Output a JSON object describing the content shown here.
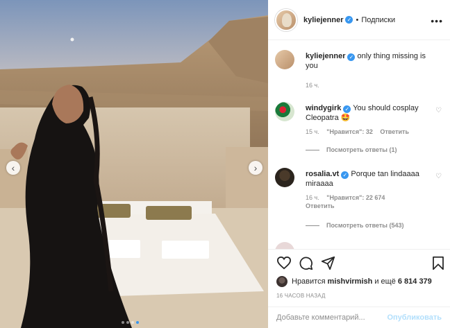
{
  "header": {
    "username": "kyliejenner",
    "separator": "•",
    "follow_label": "Подписки",
    "more_icon": "ellipsis-icon"
  },
  "caption": {
    "username": "kyliejenner",
    "text": "only thing missing is you",
    "time": "16 ч."
  },
  "comments": [
    {
      "username": "windygirk",
      "text": "You should cosplay Cleopatra 🤩",
      "time": "15 ч.",
      "likes": "\"Нравится\": 32",
      "reply_label": "Ответить",
      "view_replies": "Посмотреть ответы (1)"
    },
    {
      "username": "rosalia.vt",
      "text": "Porque tan lindaaaa miraaaa",
      "time": "16 ч.",
      "likes": "\"Нравится\": 22 674",
      "reply_label": "Ответить",
      "view_replies": "Посмотреть ответы (543)"
    }
  ],
  "actions": {
    "liked_by_prefix": "Нравится",
    "liked_by_user": "mishvirmish",
    "liked_by_and": "и ещё",
    "liked_by_count": "6 814 379",
    "timestamp": "16 ЧАСОВ НАЗАД"
  },
  "add_comment": {
    "placeholder": "Добавьте комментарий...",
    "post_label": "Опубликовать"
  },
  "carousel": {
    "dot_count": 4,
    "active_index": 3
  },
  "colors": {
    "verified": "#3897f0",
    "post_button": "#b2dffc",
    "muted_text": "#8e8e8e"
  }
}
